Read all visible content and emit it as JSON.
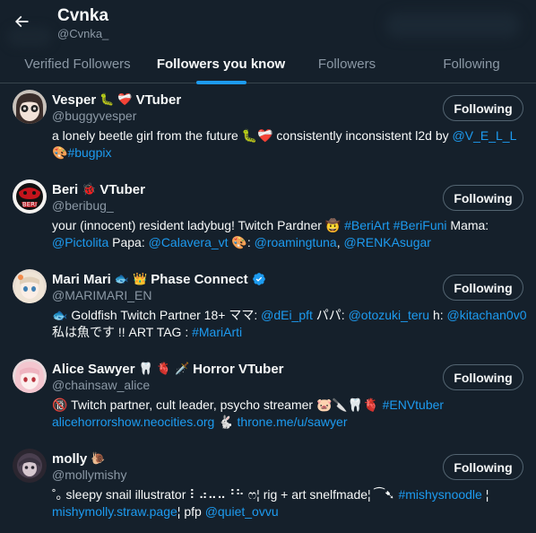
{
  "header": {
    "title": "Cvnka",
    "handle": "@Cvnka_"
  },
  "tabs": [
    {
      "label": "Verified Followers",
      "active": false
    },
    {
      "label": "Followers you know",
      "active": true
    },
    {
      "label": "Followers",
      "active": false
    },
    {
      "label": "Following",
      "active": false
    }
  ],
  "colors": {
    "background": "#15202b",
    "accent": "#1d9bf0",
    "muted_text": "#8b98a5",
    "border": "#38444d"
  },
  "follow_label": "Following",
  "users": [
    {
      "name": "Vesper",
      "name_suffix": "VTuber",
      "name_emojis": [
        "caterpillar-emoji",
        "heart-emoji"
      ],
      "handle": "@buggyvesper",
      "bio": [
        {
          "t": "a lonely beetle girl from the future 🐛❤️‍🩹 consistently inconsistent l2d by "
        },
        {
          "t": "@V_E_L_L",
          "link": true
        },
        {
          "t": " 🎨"
        },
        {
          "t": "#bugpix",
          "link": true
        }
      ]
    },
    {
      "name": "Beri",
      "name_suffix": "VTuber",
      "name_emojis": [
        "ladybug-emoji"
      ],
      "handle": "@beribug_",
      "bio": [
        {
          "t": "your (innocent) resident ladybug! Twitch Pardner 🤠 "
        },
        {
          "t": "#BeriArt",
          "link": true
        },
        {
          "t": " "
        },
        {
          "t": "#BeriFuni",
          "link": true
        },
        {
          "t": " Mama: "
        },
        {
          "t": "@Pictolita",
          "link": true
        },
        {
          "t": " Papa: "
        },
        {
          "t": "@Calavera_vt",
          "link": true
        },
        {
          "t": " 🎨: "
        },
        {
          "t": "@roamingtuna",
          "link": true
        },
        {
          "t": ", "
        },
        {
          "t": "@RENKAsugar",
          "link": true
        }
      ]
    },
    {
      "name": "Mari Mari",
      "name_suffix": "Phase Connect",
      "name_emojis": [
        "fish-emoji",
        "crown-emoji"
      ],
      "verified": true,
      "handle": "@MARIMARI_EN",
      "bio": [
        {
          "t": "🐟 Goldfish Twitch Partner 18+ ママ: "
        },
        {
          "t": "@dEi_pft",
          "link": true
        },
        {
          "t": " パパ: "
        },
        {
          "t": "@otozuki_teru",
          "link": true
        },
        {
          "t": " h: "
        },
        {
          "t": "@kitachan0v0",
          "link": true
        },
        {
          "t": " 私は魚です !! ART TAG : "
        },
        {
          "t": "#MariArti",
          "link": true
        }
      ]
    },
    {
      "name": "Alice Sawyer",
      "name_suffix": "Horror VTuber",
      "name_emojis": [
        "tooth-emoji",
        "anatomical-heart-emoji",
        "knife-emoji"
      ],
      "handle": "@chainsaw_alice",
      "bio": [
        {
          "t": "🔞 Twitch partner, cult leader, psycho streamer 🐷🔪🦷🫀 "
        },
        {
          "t": "#ENVtuber",
          "link": true
        },
        {
          "t": " "
        },
        {
          "t": "alicehorrorshow.neocities.org",
          "link": true
        },
        {
          "t": " 🐇 "
        },
        {
          "t": "throne.me/u/sawyer",
          "link": true
        }
      ]
    },
    {
      "name": "molly",
      "name_suffix": "",
      "name_emojis": [
        "snail-emoji"
      ],
      "handle": "@mollymishy",
      "bio": [
        {
          "t": "˚｡ sleepy snail illustrator ⠇⠴⠤⠤⠘⠓ ෆ¦ rig + art snelfmade¦ ⁀➷ "
        },
        {
          "t": "#mishysnoodle",
          "link": true
        },
        {
          "t": " ¦ "
        },
        {
          "t": "mishymolly.straw.page",
          "link": true
        },
        {
          "t": "¦ pfp "
        },
        {
          "t": "@quiet_ovvu",
          "link": true
        }
      ]
    }
  ]
}
